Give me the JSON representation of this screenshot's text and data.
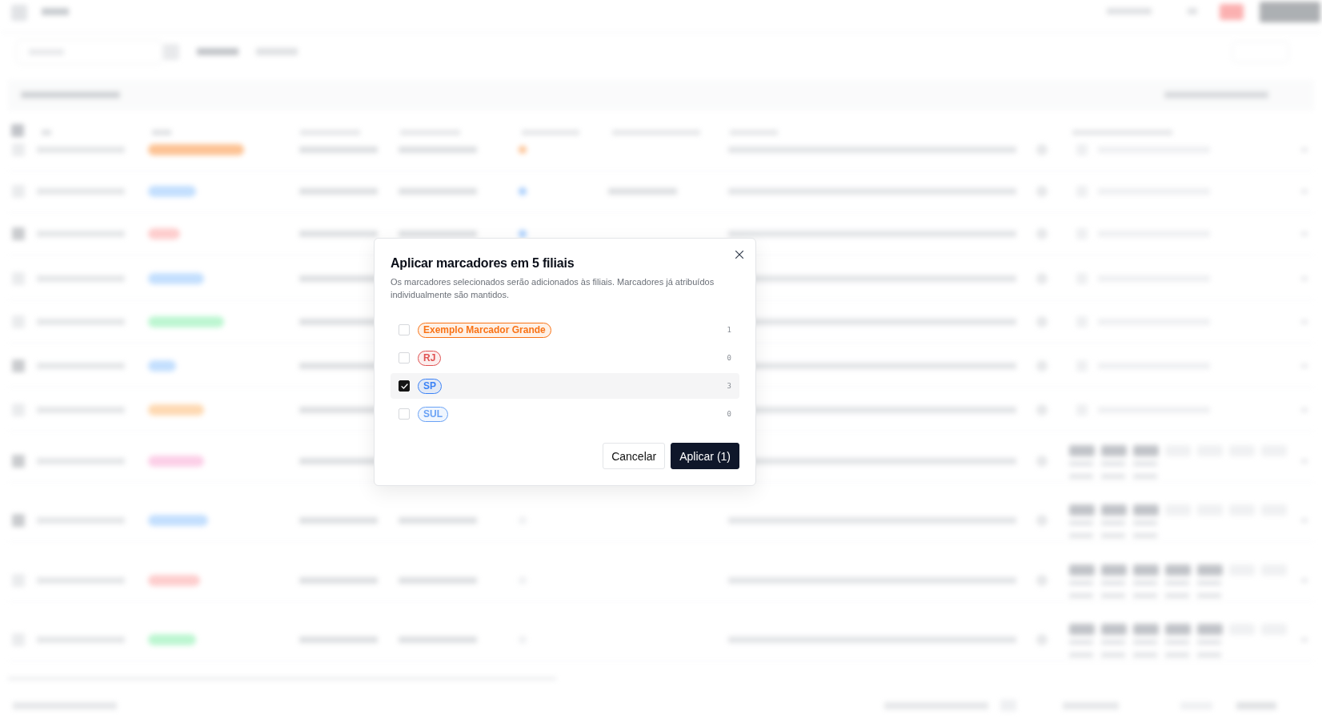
{
  "dialog": {
    "title": "Aplicar marcadores em 5 filiais",
    "description": "Os marcadores selecionados serão adicionados às filiais. Marcadores já atribuídos individualmente são mantidos.",
    "tags": [
      {
        "label": "Exemplo Marcador Grande",
        "color": "#f97316",
        "count": "1",
        "checked": false
      },
      {
        "label": "RJ",
        "color": "#e05252",
        "count": "0",
        "checked": false
      },
      {
        "label": "SP",
        "color": "#3b82f6",
        "count": "3",
        "checked": true
      },
      {
        "label": "SUL",
        "color": "#6aa2f5",
        "count": "0",
        "checked": false
      }
    ],
    "buttons": [
      {
        "label": "Cancelar",
        "kind": "secondary"
      },
      {
        "label": "Aplicar (1)",
        "kind": "primary"
      }
    ]
  }
}
